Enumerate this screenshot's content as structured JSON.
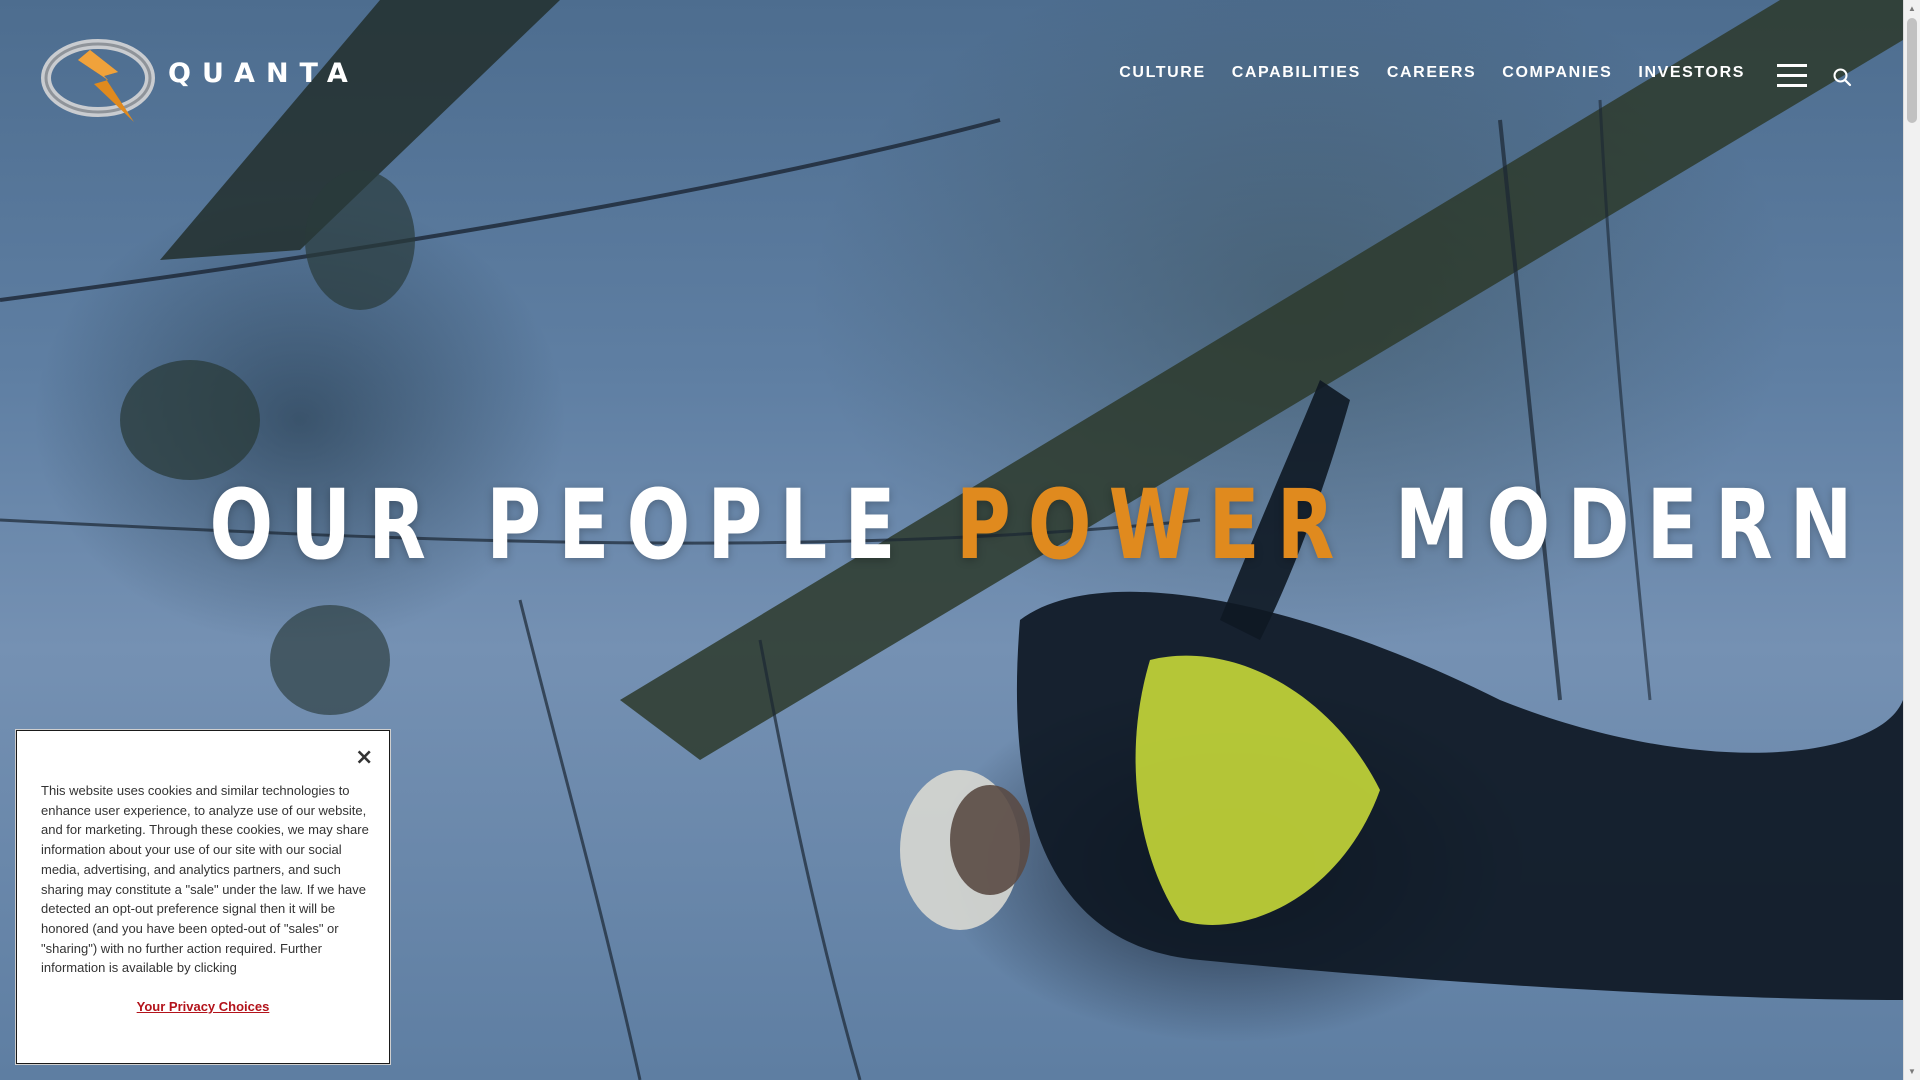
{
  "brand": {
    "name": "QUANTA",
    "logo_icon": "lightning-bolt-ring-logo",
    "accent_color": "#e08a1e"
  },
  "nav": {
    "items": [
      {
        "label": "CULTURE"
      },
      {
        "label": "CAPABILITIES"
      },
      {
        "label": "CAREERS"
      },
      {
        "label": "COMPANIES"
      },
      {
        "label": "INVESTORS"
      }
    ],
    "menu_icon": "hamburger-menu-icon",
    "search_icon": "search-icon"
  },
  "hero": {
    "headline_before": "OUR PEOPLE ",
    "headline_accent": "POWER",
    "headline_after": " MODERN LIFE",
    "background": "lineworker-on-utility-pole-video"
  },
  "cookie_banner": {
    "close_icon": "close-icon",
    "text": "This website uses cookies and similar technologies to enhance user experience, to analyze use of our website, and for marketing. Through these cookies, we may share information about your use of our site with our social media, advertising, and analytics partners, and such sharing may constitute a \"sale\" under the law. If we have detected an opt-out preference signal then it will be honored (and you have been opted-out of \"sales\" or \"sharing\") with no further action required. Further information is available by clicking",
    "link_label": "Your Privacy Choices",
    "link_color": "#b3131b"
  }
}
